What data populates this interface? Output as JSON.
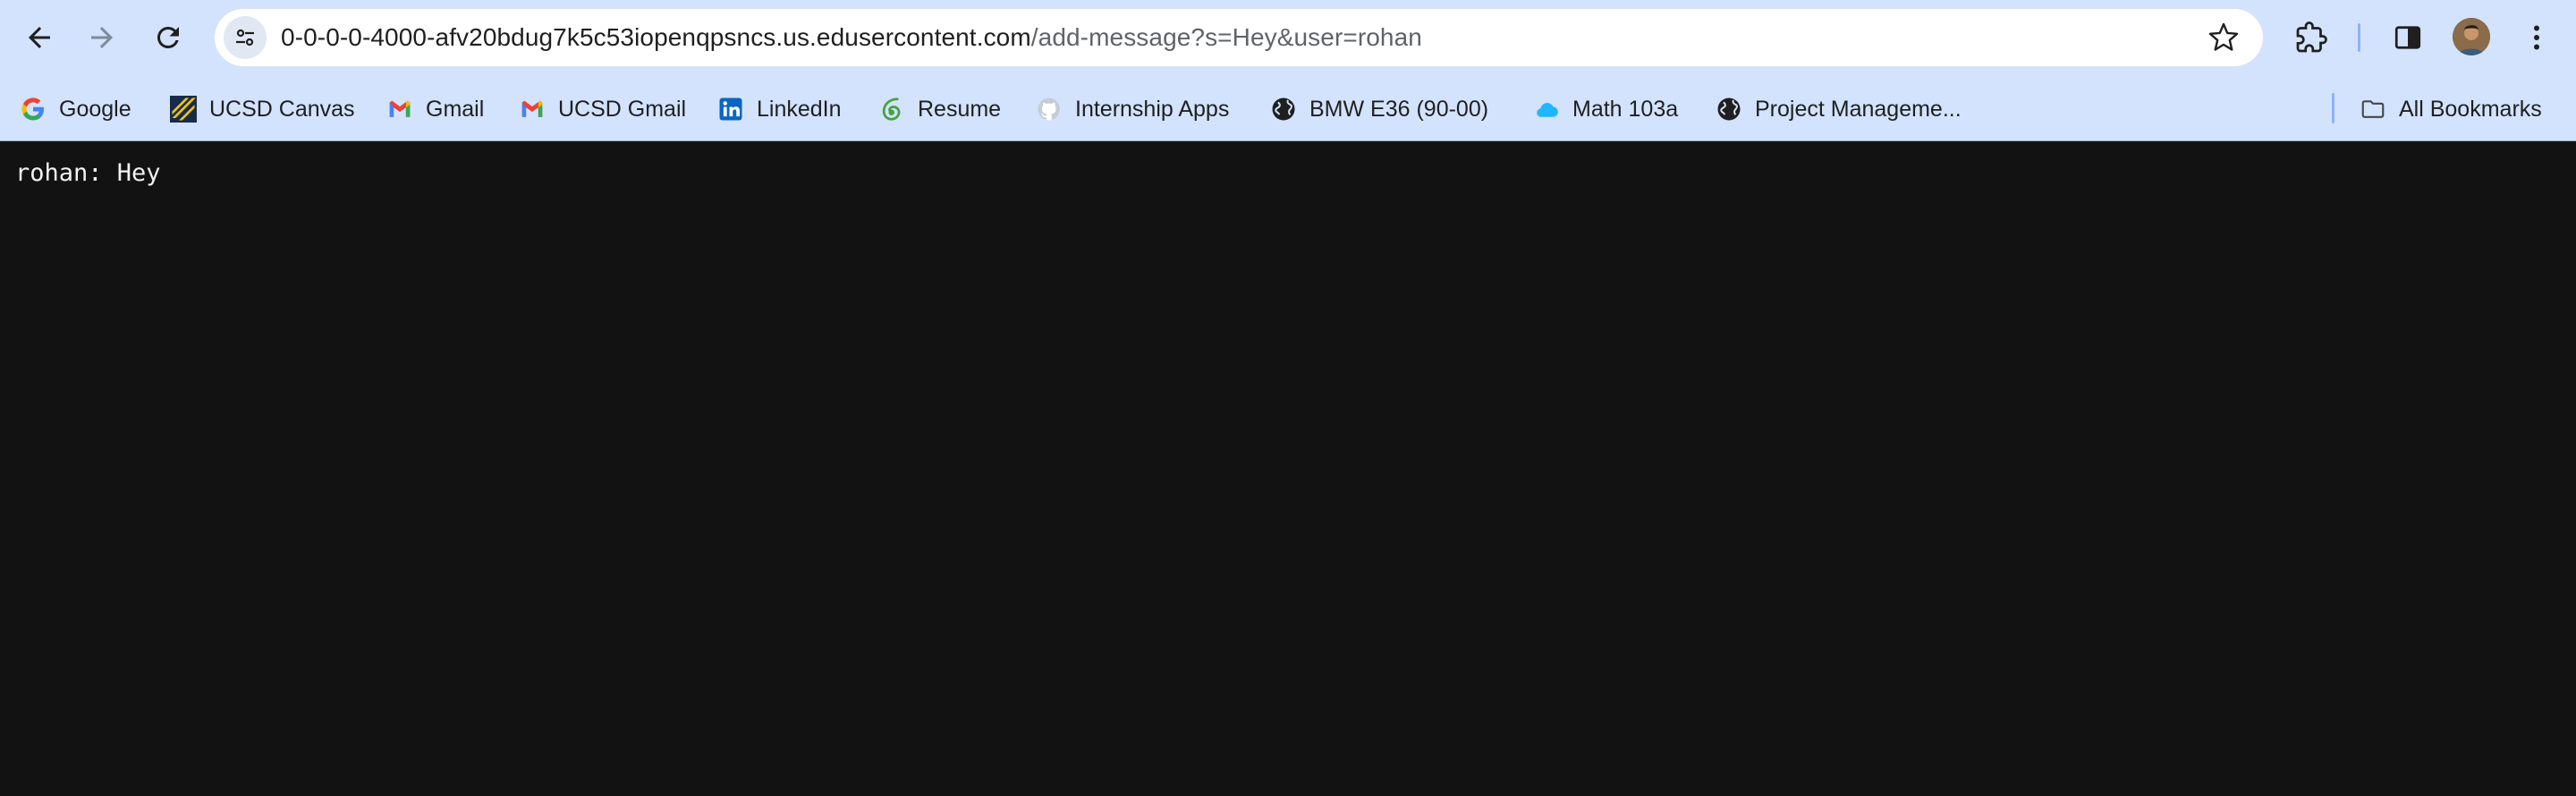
{
  "toolbar": {
    "back_icon": "arrow-left-icon",
    "forward_icon": "arrow-right-icon",
    "reload_icon": "reload-icon",
    "site_info_icon": "tune-icon",
    "bookmark_star_icon": "star-outline-icon",
    "extensions_icon": "puzzle-icon",
    "side_panel_icon": "side-panel-icon",
    "menu_icon": "kebab-menu-icon"
  },
  "address_bar": {
    "host": "0-0-0-0-4000-afv20bdug7k5c53iopenqpsncs.us.edusercontent.com",
    "path": "/add-message?s=Hey&user=rohan"
  },
  "bookmarks": [
    {
      "label": "Google",
      "icon": "google-icon"
    },
    {
      "label": "UCSD Canvas",
      "icon": "canvas-icon"
    },
    {
      "label": "Gmail",
      "icon": "gmail-icon"
    },
    {
      "label": "UCSD Gmail",
      "icon": "gmail-icon"
    },
    {
      "label": "LinkedIn",
      "icon": "linkedin-icon"
    },
    {
      "label": "Resume",
      "icon": "overleaf-icon"
    },
    {
      "label": "Internship Apps",
      "icon": "github-icon"
    },
    {
      "label": "BMW E36 (90-00)",
      "icon": "globe-icon"
    },
    {
      "label": "Math 103a",
      "icon": "cloud-icon"
    },
    {
      "label": "Project Manageme...",
      "icon": "globe-icon"
    }
  ],
  "all_bookmarks": {
    "label": "All Bookmarks",
    "icon": "folder-icon"
  },
  "page": {
    "message": "rohan: Hey"
  },
  "colors": {
    "chrome_background": "#d3e3fd",
    "page_background": "#121212",
    "page_text": "#f2f2f2",
    "separator_accent": "#8ab4f8"
  }
}
